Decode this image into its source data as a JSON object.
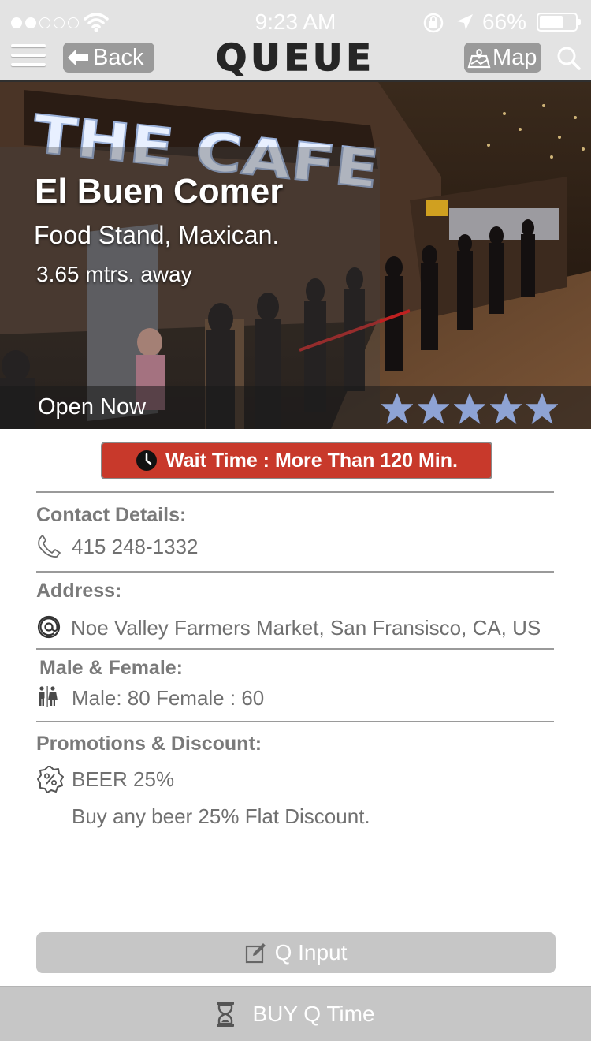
{
  "status_bar": {
    "time": "9:23 AM",
    "battery_percent": "66%",
    "battery_level": 0.66,
    "signal_bars_filled": 2,
    "signal_bars_total": 5
  },
  "nav": {
    "back_label": "Back",
    "logo_text": "QUEUE",
    "map_label": "Map"
  },
  "venue": {
    "name": "El Buen Comer",
    "category": "Food Stand, Maxican.",
    "distance": "3.65 mtrs. away",
    "open_status": "Open Now",
    "rating": 5,
    "rating_max": 5,
    "sign_text": "THE CAFE"
  },
  "wait": {
    "label": "Wait Time : More Than 120 Min.",
    "color": "#c8392b"
  },
  "contact": {
    "title": "Contact Details:",
    "phone": "415 248-1332"
  },
  "address": {
    "title": "Address:",
    "value": "Noe Valley Farmers Market, San Fransisco, CA, US"
  },
  "gender": {
    "title": "Male & Female:",
    "value": "Male: 80 Female : 60"
  },
  "promotions": {
    "title": "Promotions & Discount:",
    "offer": "BEER 25%",
    "description": "Buy any beer 25% Flat Discount."
  },
  "actions": {
    "q_input_label": "Q Input",
    "buy_label": "BUY Q Time"
  },
  "colors": {
    "accent_red": "#c8392b",
    "star_blue": "#8ea3d4",
    "topbar_bg": "#e3e3e3",
    "button_gray": "#c6c6c6"
  }
}
